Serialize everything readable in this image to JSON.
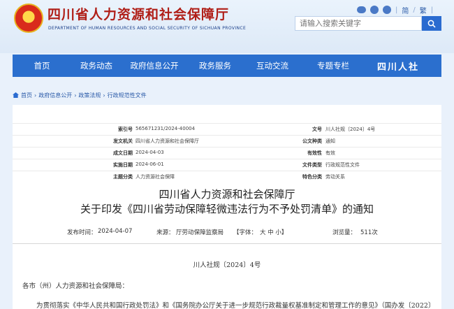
{
  "header": {
    "title": "四川省人力资源和社会保障厅",
    "subtitle": "DEPARTMENT OF HUMAN RESOURCES AND SOCIAL SECURITY OF SICHUAN PROVINCE",
    "top_links": {
      "simplified": "简",
      "traditional": "繁"
    },
    "search_placeholder": "请输入搜索关键字"
  },
  "nav": {
    "items": [
      "首页",
      "政务动态",
      "政府信息公开",
      "政务服务",
      "互动交流",
      "专题专栏"
    ],
    "logo_text": "四川人社"
  },
  "breadcrumb": [
    "首页",
    "政府信息公开",
    "政策法规",
    "行政规范性文件"
  ],
  "meta": [
    {
      "k1": "索引号",
      "v1": "565671231/2024-40004",
      "k2": "文号",
      "v2": "川人社规〔2024〕4号"
    },
    {
      "k1": "发文机关",
      "v1": "四川省人力资源和社会保障厅",
      "k2": "公文种类",
      "v2": "通知"
    },
    {
      "k1": "成文日期",
      "v1": "2024-04-03",
      "k2": "有效性",
      "v2": "有效"
    },
    {
      "k1": "实施日期",
      "v1": "2024-06-01",
      "k2": "文件类型",
      "v2": "行政规范性文件"
    },
    {
      "k1": "主题分类",
      "v1": "人力资源社会保障",
      "k2": "特色分类",
      "v2": "劳动关系"
    }
  ],
  "doc": {
    "title_line1": "四川省人力资源和社会保障厅",
    "title_line2": "关于印发《四川省劳动保障轻微违法行为不予处罚清单》的通知",
    "pub_date_label": "发布时间：",
    "pub_date": "2024-04-07",
    "source_label": "来源：",
    "source": "厅劳动保障监察局",
    "font_label": "【字体：",
    "font_size_options": "大 中 小】",
    "views_label": "浏览量：",
    "views": "511次",
    "doc_no": "川人社规〔2024〕4号",
    "greeting": "各市（州）人力资源和社会保障局：",
    "para_start": "为贯彻落实《中华人民共和国行政处罚法》和《国务院办公厅关于进一步规范行政裁量权基准制定和管理工作的意见》（国办发〔2022〕"
  },
  "colors": {
    "nav_bg": "#2b6fce",
    "title_red": "#b01e17",
    "link_blue": "#2a5aa8"
  }
}
